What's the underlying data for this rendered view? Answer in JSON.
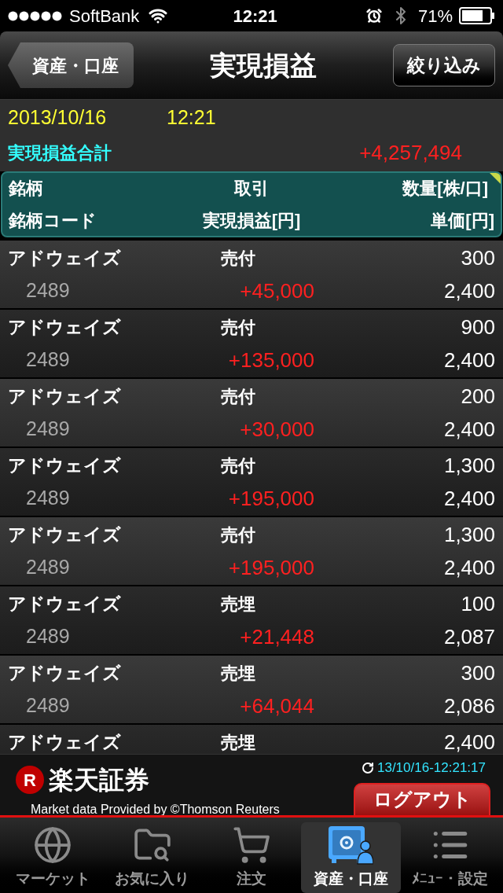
{
  "status_bar": {
    "carrier": "SoftBank",
    "time": "12:21",
    "battery": "71%"
  },
  "nav_bar": {
    "back_button": "資産・口座",
    "title": "実現損益",
    "filter_button": "絞り込み"
  },
  "summary": {
    "date": "2013/10/16",
    "time": "12:21",
    "total_label": "実現損益合計",
    "total_value": "+4,257,494"
  },
  "table": {
    "header_top": [
      "銘柄",
      "取引",
      "数量[株/口]"
    ],
    "header_bottom": [
      "銘柄コード",
      "実現損益[円]",
      "単価[円]"
    ],
    "rows": [
      {
        "name": "アドウェイズ",
        "trade": "売付",
        "quantity": "300",
        "code": "2489",
        "profit": "+45,000",
        "price": "2,400"
      },
      {
        "name": "アドウェイズ",
        "trade": "売付",
        "quantity": "900",
        "code": "2489",
        "profit": "+135,000",
        "price": "2,400"
      },
      {
        "name": "アドウェイズ",
        "trade": "売付",
        "quantity": "200",
        "code": "2489",
        "profit": "+30,000",
        "price": "2,400"
      },
      {
        "name": "アドウェイズ",
        "trade": "売付",
        "quantity": "1,300",
        "code": "2489",
        "profit": "+195,000",
        "price": "2,400"
      },
      {
        "name": "アドウェイズ",
        "trade": "売付",
        "quantity": "1,300",
        "code": "2489",
        "profit": "+195,000",
        "price": "2,400"
      },
      {
        "name": "アドウェイズ",
        "trade": "売埋",
        "quantity": "100",
        "code": "2489",
        "profit": "+21,448",
        "price": "2,087"
      },
      {
        "name": "アドウェイズ",
        "trade": "売埋",
        "quantity": "300",
        "code": "2489",
        "profit": "+64,044",
        "price": "2,086"
      },
      {
        "name": "アドウェイズ",
        "trade": "売埋",
        "quantity": "2,400"
      }
    ]
  },
  "footer": {
    "logo_mark": "R",
    "logo_name": "楽天証券",
    "updated": "13/10/16-12:21:17",
    "logout_button": "ログアウト",
    "credit": "Market data Provided by ©Thomson Reuters"
  },
  "tab_bar": [
    {
      "label": "マーケット",
      "selected": false
    },
    {
      "label": "お気に入り",
      "selected": false
    },
    {
      "label": "注文",
      "selected": false
    },
    {
      "label": "資産・口座",
      "selected": true
    },
    {
      "label": "ﾒﾆｭｰ・設定",
      "selected": false
    }
  ]
}
